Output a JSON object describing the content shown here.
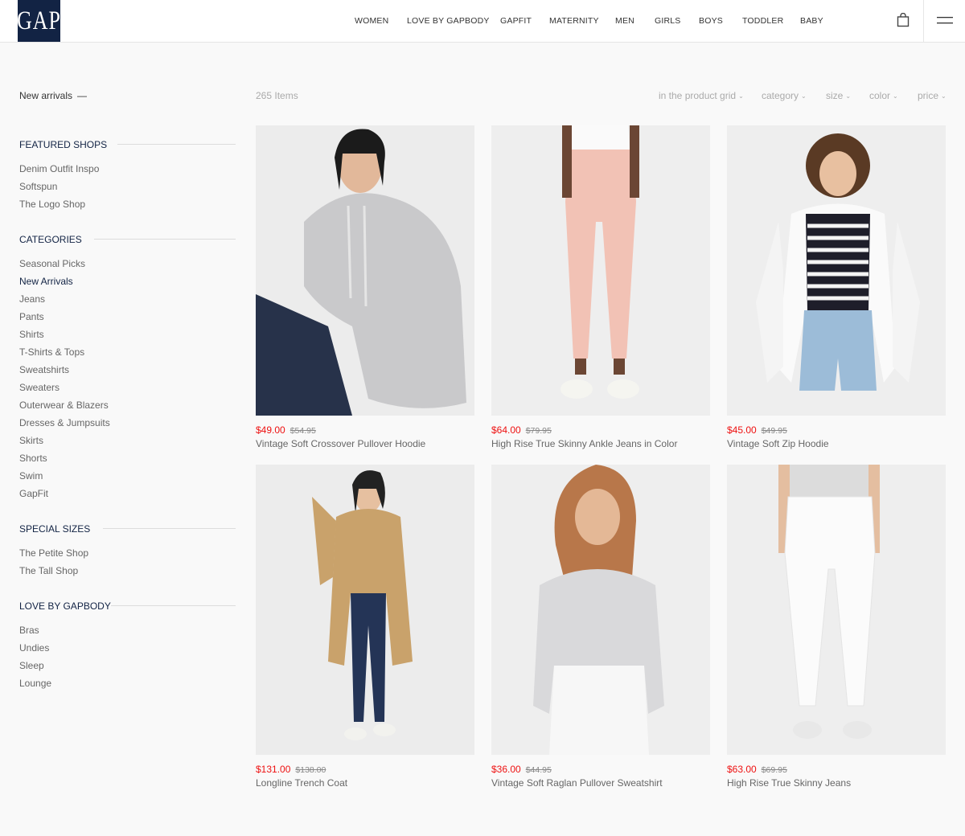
{
  "header": {
    "logo_text": "GAP",
    "nav": [
      "WOMEN",
      "LOVE BY GAPBODY",
      "GAPFIT",
      "MATERNITY",
      "MEN",
      "GIRLS",
      "BOYS",
      "TODDLER",
      "BABY"
    ],
    "brand_color": "#122344"
  },
  "breadcrumb": {
    "label": "New arrivals",
    "separator": "—"
  },
  "sidebar": {
    "featured": {
      "title": "FEATURED SHOPS",
      "items": [
        "Denim Outfit Inspo",
        "Softspun",
        "The Logo Shop"
      ]
    },
    "categories": {
      "title": "CATEGORIES",
      "items": [
        "Seasonal Picks",
        "New Arrivals",
        "Jeans",
        "Pants",
        "Shirts",
        "T-Shirts & Tops",
        "Sweatshirts",
        "Sweaters",
        "Outerwear & Blazers",
        "Dresses & Jumpsuits",
        "Skirts",
        "Shorts",
        "Swim",
        "GapFit"
      ],
      "active": "New Arrivals"
    },
    "special": {
      "title": "SPECIAL SIZES",
      "items": [
        "The Petite Shop",
        "The Tall Shop"
      ]
    },
    "gapbody": {
      "title": "LOVE BY GAPBODY",
      "items": [
        "Bras",
        "Undies",
        "Sleep",
        "Lounge"
      ]
    }
  },
  "toolbar": {
    "count": "265 Items",
    "filters": [
      "in the product grid",
      "category",
      "size",
      "color",
      "price"
    ]
  },
  "products": [
    {
      "price": "$49.00",
      "old_price": "$54.95",
      "name": "Vintage Soft Crossover Pullover Hoodie"
    },
    {
      "price": "$64.00",
      "old_price": "$79.95",
      "name": "High Rise True Skinny Ankle Jeans in Color"
    },
    {
      "price": "$45.00",
      "old_price": "$49.95",
      "name": "Vintage Soft Zip Hoodie"
    },
    {
      "price": "$131.00",
      "old_price": "$138.00",
      "name": "Longline Trench Coat"
    },
    {
      "price": "$36.00",
      "old_price": "$44.95",
      "name": "Vintage Soft Raglan Pullover Sweatshirt"
    },
    {
      "price": "$63.00",
      "old_price": "$69.95",
      "name": "High Rise True Skinny Jeans"
    }
  ],
  "colors": {
    "sale": "#ee1111",
    "accent": "#122344"
  }
}
